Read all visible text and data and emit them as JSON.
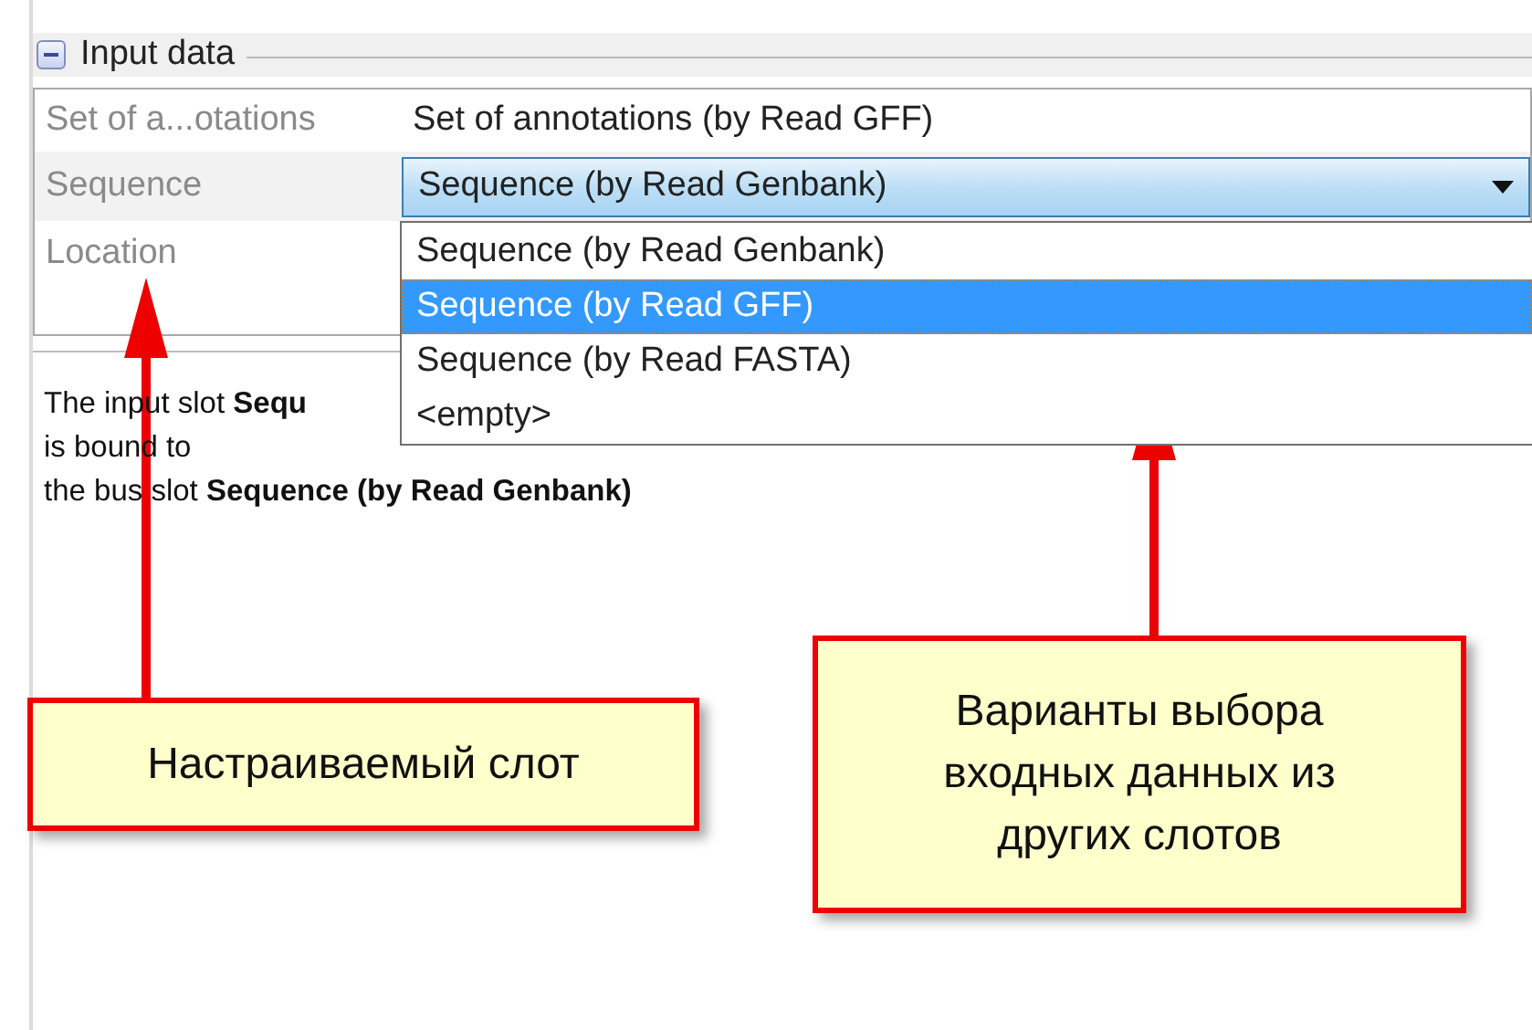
{
  "group": {
    "title": "Input data",
    "expanded": true
  },
  "properties": [
    {
      "label": "Set of a...otations",
      "kind": "text",
      "value": "Set of annotations (by Read GFF)",
      "selected": false
    },
    {
      "label": "Sequence",
      "kind": "combo",
      "value": "Sequence (by Read Genbank)",
      "selected": true
    },
    {
      "label": "Location",
      "kind": "empty",
      "selected": false
    }
  ],
  "dropdown": {
    "options": [
      {
        "label": "Sequence (by Read Genbank)",
        "selected": false
      },
      {
        "label": "Sequence (by Read GFF)",
        "selected": true
      },
      {
        "label": "Sequence (by Read FASTA)",
        "selected": false
      },
      {
        "label": "<empty>",
        "selected": false
      }
    ]
  },
  "description": [
    "The input slot **Sequ**",
    "is bound to",
    "the bus slot **Sequence (by Read Genbank)**"
  ],
  "callouts": [
    {
      "text": "Настраиваемый слот"
    },
    {
      "text": "Варианты выбора входных данных из других слотов"
    }
  ]
}
